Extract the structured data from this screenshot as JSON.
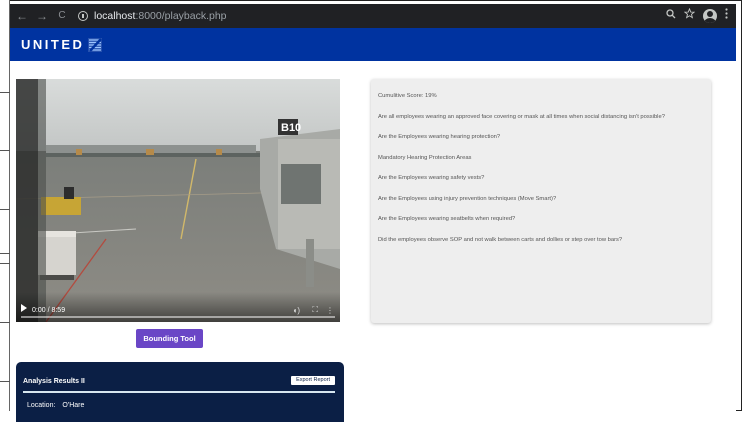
{
  "browser": {
    "url_host": "localhost",
    "url_path": ":8000/playback.php",
    "nav": {
      "back": "←",
      "forward": "→",
      "reload": "C"
    },
    "icons": [
      "zoom-icon",
      "star-icon",
      "profile-icon",
      "menu-icon"
    ]
  },
  "header": {
    "brand": "UNITED",
    "brand_color": "#0033a0"
  },
  "video": {
    "time": "0:00 / 8:59",
    "gate_sign": "B10",
    "progress": 0
  },
  "bounding_tool": {
    "label": "Bounding Tool",
    "color": "#6a46c6"
  },
  "analysis": {
    "title": "Analysis Results II",
    "export_label": "Export Report",
    "location_label": "Location:",
    "location_value": "O'Hare"
  },
  "questions": {
    "items": [
      "Cumulitive Score: 19%",
      "Are all employees wearing an approved face covering or mask at all times when social distancing isn't possible?",
      "Are the Employees wearing hearing protection?",
      "Mandatory Hearing Protection Areas",
      "Are the Employees wearing safety vests?",
      "Are the Employees using injury prevention techniques (Move Smart)?",
      "Are the Employees wearing seatbelts when required?",
      "Did the employees observe SOP and not walk between carts and dollies or step over tow bars?"
    ]
  }
}
